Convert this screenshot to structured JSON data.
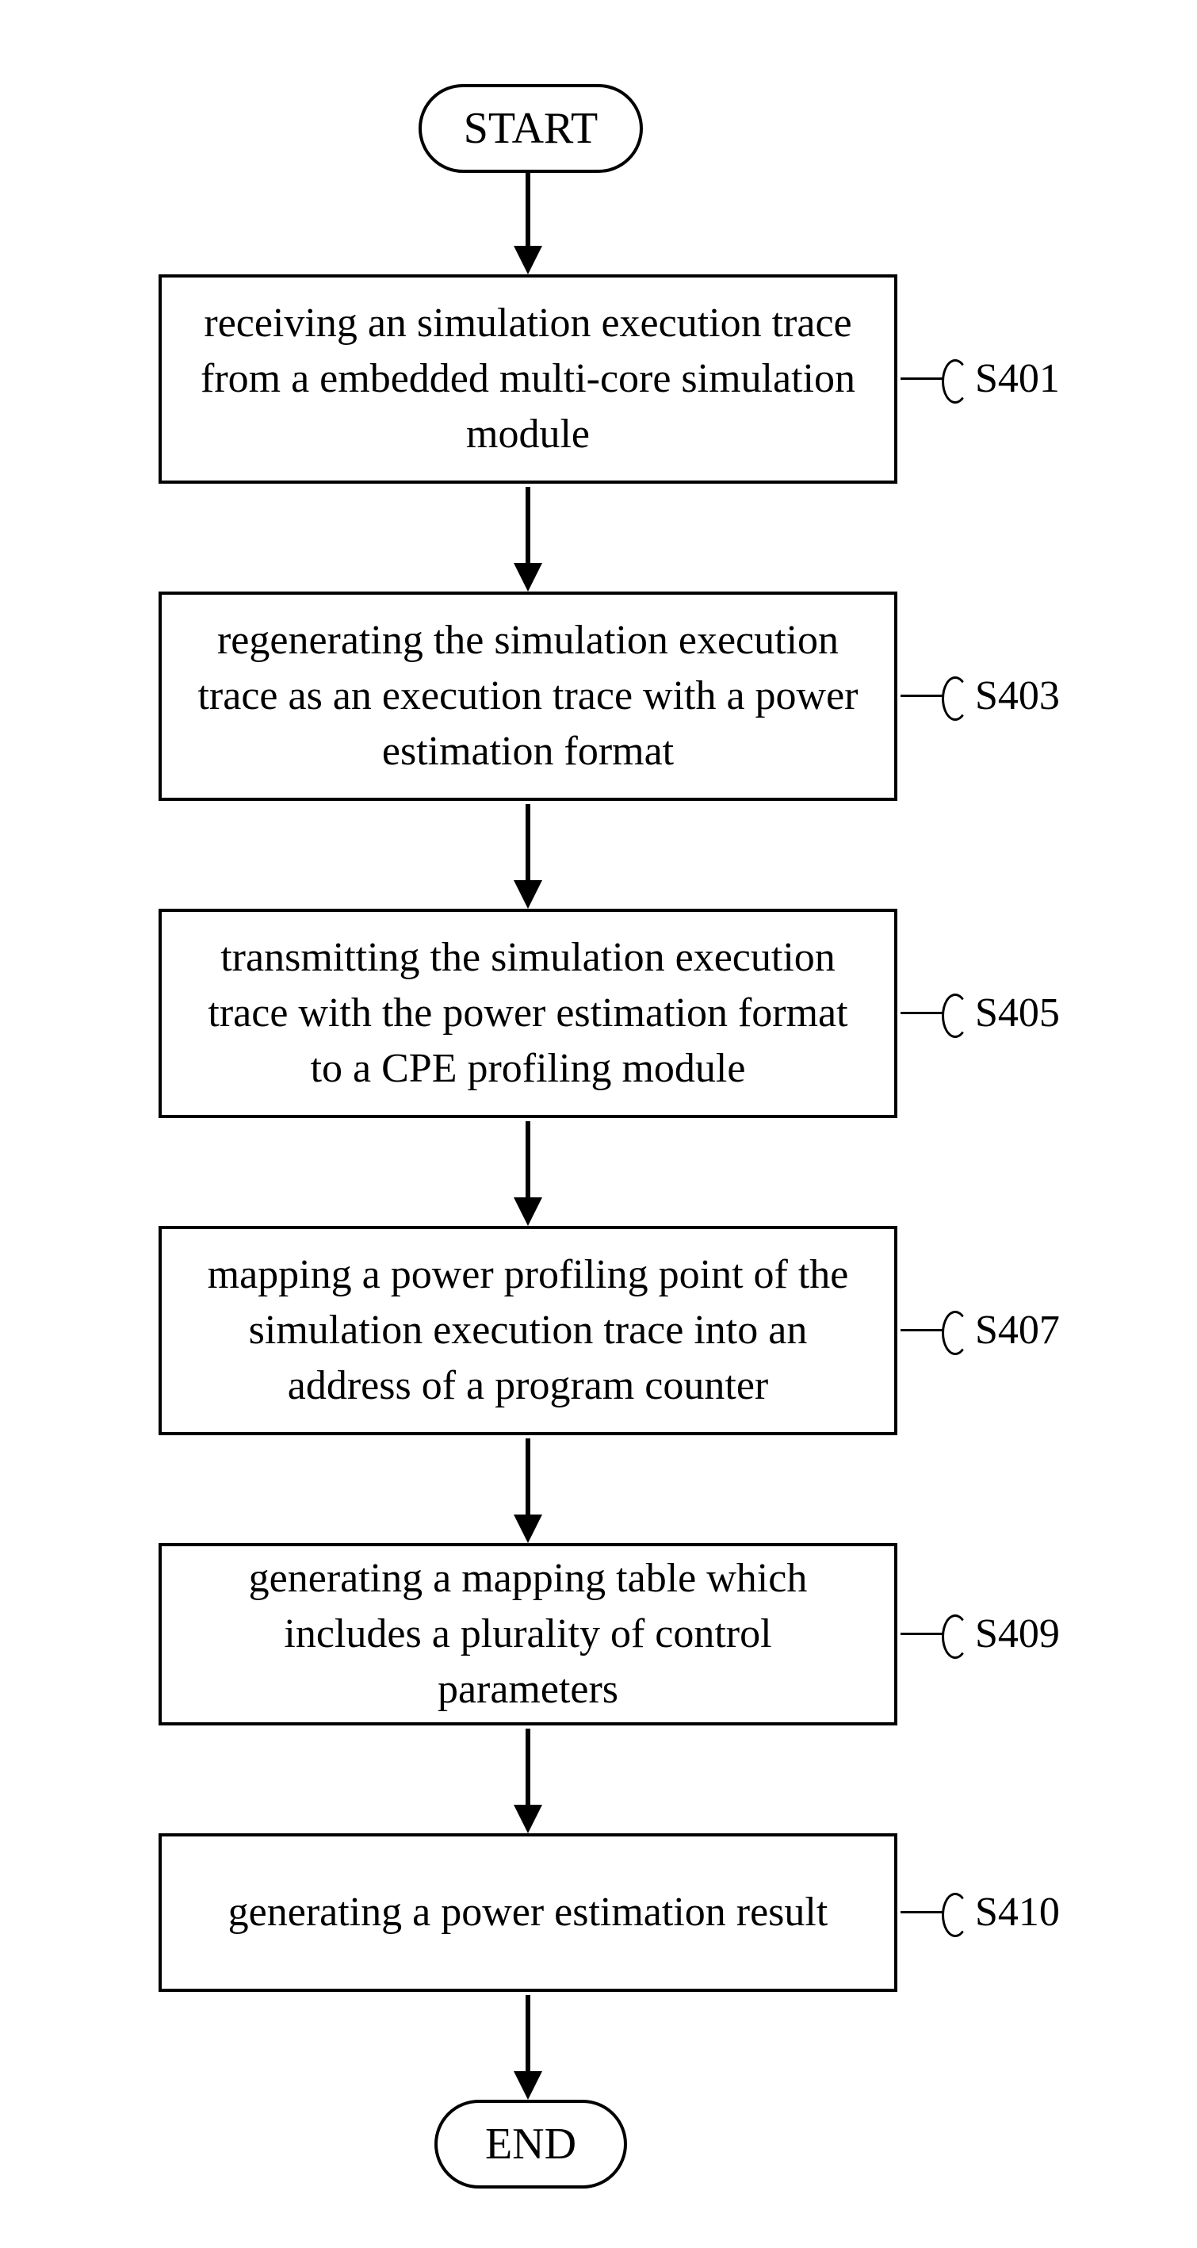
{
  "terminators": {
    "start": "START",
    "end": "END"
  },
  "steps": {
    "s401": {
      "text": "receiving an simulation execution trace from a embedded multi-core simulation module",
      "label": "S401"
    },
    "s403": {
      "text": "regenerating the simulation execution trace as an execution trace with a power estimation format",
      "label": "S403"
    },
    "s405": {
      "text": "transmitting the simulation execution trace with the power estimation format to a CPE profiling module",
      "label": "S405"
    },
    "s407": {
      "text": "mapping a power profiling point of the simulation execution trace into an address of a program counter",
      "label": "S407"
    },
    "s409": {
      "text": "generating a mapping table which includes a plurality of control parameters",
      "label": "S409"
    },
    "s410": {
      "text": "generating a power estimation result",
      "label": "S410"
    }
  }
}
